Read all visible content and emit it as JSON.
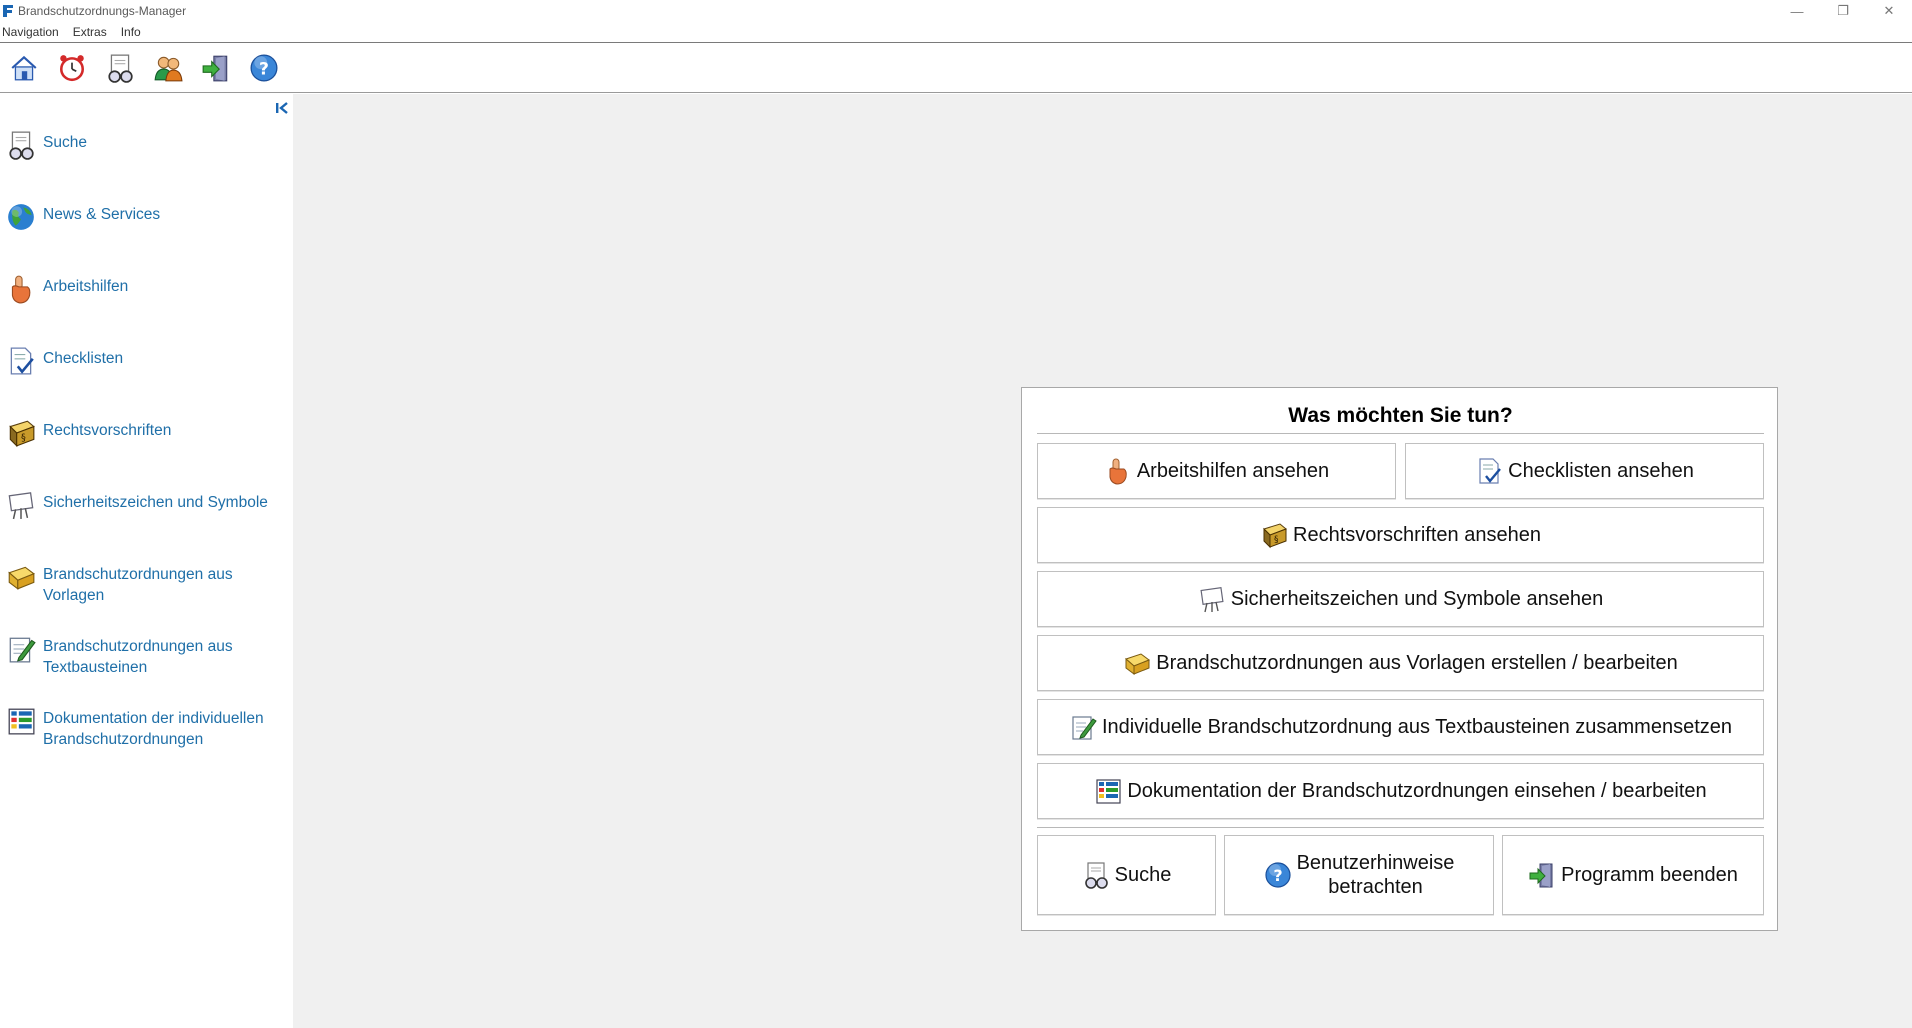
{
  "window": {
    "title": "Brandschutzordnungs-Manager",
    "controls": {
      "minimize": "—",
      "restore": "❐",
      "close": "✕"
    }
  },
  "menu": [
    "Navigation",
    "Extras",
    "Info"
  ],
  "toolbar": {
    "icons": [
      "home-icon",
      "alarm-clock-icon",
      "search-icon",
      "users-icon",
      "exit-icon",
      "help-icon"
    ]
  },
  "sidebar": {
    "items": [
      {
        "label": "Suche",
        "icon": "search-icon"
      },
      {
        "label": "News & Services",
        "icon": "globe-icon"
      },
      {
        "label": "Arbeitshilfen",
        "icon": "hand-icon"
      },
      {
        "label": "Checklisten",
        "icon": "checklist-icon"
      },
      {
        "label": "Rechtsvorschriften",
        "icon": "law-book-icon"
      },
      {
        "label": "Sicherheitszeichen und Symbole",
        "icon": "presentation-board-icon"
      },
      {
        "label": "Brandschutzordnungen aus Vorlagen",
        "icon": "template-book-icon"
      },
      {
        "label": "Brandschutzordnungen aus Textbausteinen",
        "icon": "edit-document-icon"
      },
      {
        "label": "Dokumentation der individuellen Brandschutzordnungen",
        "icon": "documentation-grid-icon"
      }
    ]
  },
  "dialog": {
    "title": "Was möchten Sie tun?",
    "buttons": {
      "arbeitshilfen": "Arbeitshilfen ansehen",
      "checklisten": "Checklisten ansehen",
      "rechtsvorschriften": "Rechtsvorschriften ansehen",
      "sicherheitszeichen": "Sicherheitszeichen und Symbole ansehen",
      "vorlagen": "Brandschutzordnungen aus Vorlagen erstellen / bearbeiten",
      "textbausteine": "Individuelle Brandschutzordnung aus Textbausteinen zusammensetzen",
      "dokumentation": "Dokumentation der Brandschutzordnungen einsehen / bearbeiten",
      "suche": "Suche",
      "hinweise_line1": "Benutzerhinweise",
      "hinweise_line2": "betrachten",
      "beenden": "Programm beenden"
    }
  },
  "colors": {
    "link": "#1f6fa8",
    "main_bg": "#f0f0f0",
    "accent": "#1a66b3"
  }
}
